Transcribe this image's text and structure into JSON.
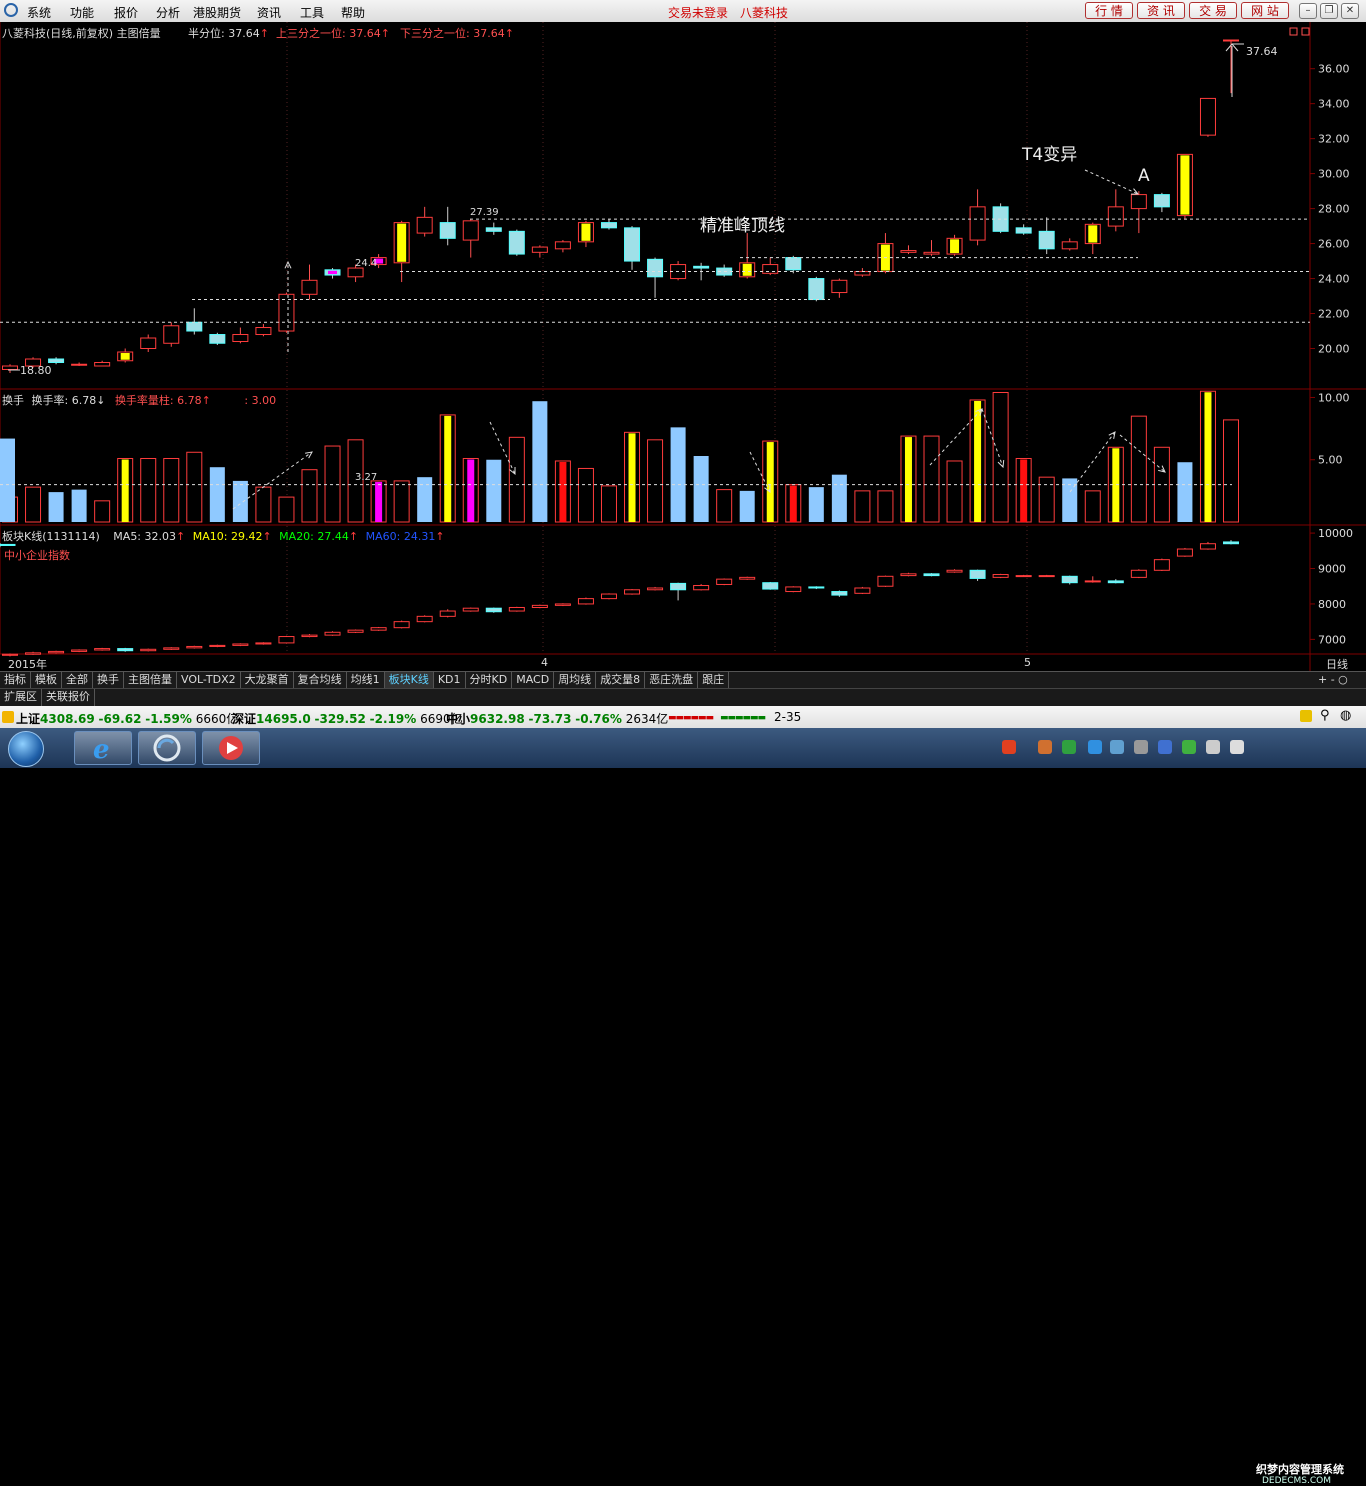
{
  "menu": {
    "items": [
      "系统",
      "功能",
      "报价",
      "分析",
      "港股期货",
      "资讯",
      "工具",
      "帮助"
    ],
    "status_login": "交易未登录",
    "status_brand": "八菱科技"
  },
  "toolbar": {
    "buttons": [
      "行 情",
      "资 讯",
      "交 易",
      "网 站"
    ]
  },
  "main_header": {
    "title": "八菱科技(日线,前复权) 主图倍量",
    "items": [
      {
        "label": "半分位:",
        "value": "37.64",
        "arrow": "↑"
      },
      {
        "label": "上三分之一位:",
        "value": "37.64",
        "arrow": "↑"
      },
      {
        "label": "下三分之一位:",
        "value": "37.64",
        "arrow": "↑"
      }
    ]
  },
  "annotations": {
    "peak_line": "精准峰顶线",
    "t4": "T4变异",
    "a": "A",
    "high": "37.64",
    "low": "18.80",
    "p2739": "27.39",
    "p244": "24.4",
    "p327": "3.27"
  },
  "vol_header": {
    "name": "换手",
    "l1": "换手率:",
    "v1": "6.78",
    "a1": "↓",
    "l2": "换手率量柱:",
    "v2": "6.78",
    "a2": "↑",
    "v3": ": 3.00"
  },
  "block_header": {
    "name": "板块K线(1131114)",
    "ma5": "MA5: 32.03",
    "ma10": "MA10: 29.42",
    "ma20": "MA20: 27.44",
    "ma60": "MA60: 24.31",
    "index_name": "中小企业指数"
  },
  "x_labels": {
    "year": "2015年",
    "m4": "4",
    "m5": "5",
    "period": "日线"
  },
  "tabs": [
    "指标",
    "模板",
    "全部",
    "换手",
    "主图倍量",
    "VOL-TDX2",
    "大龙聚首",
    "复合均线",
    "均线1",
    "板块K线",
    "KD1",
    "分时KD",
    "MACD",
    "周均线",
    "成交量8",
    "恶庄洗盘",
    "跟庄"
  ],
  "tab_active": "板块K线",
  "tabs2": [
    "扩展区",
    "关联报价"
  ],
  "ticker": {
    "sh": {
      "name": "上证",
      "price": "4308.69",
      "chg": "-69.62",
      "pct": "-1.59%",
      "amt": "6660亿"
    },
    "sz": {
      "name": "深证",
      "price": "14695.0",
      "chg": "-329.52",
      "pct": "-2.19%",
      "amt": "6690亿"
    },
    "zx": {
      "name": "中小",
      "price": "9632.98",
      "chg": "-73.73",
      "pct": "-0.76%",
      "amt": "2634亿"
    },
    "range": "2-35"
  },
  "watermark": "织梦内容管理系统",
  "watermark2": "DEDECMS.COM",
  "colors": {
    "up": "#ff3c3c",
    "down": "#54ffff",
    "bg": "#000000",
    "grid": "#800000",
    "yellow": "#ffff00",
    "magenta": "#ff00ff",
    "lightblue": "#8fc9ff"
  },
  "chart_data": {
    "type": "candlestick",
    "main": {
      "ylim": [
        19,
        37.64
      ],
      "yticks": [
        20,
        22,
        24,
        26,
        28,
        30,
        32,
        34,
        36
      ],
      "candles": [
        [
          18.8,
          19.0,
          18.6,
          19.1
        ],
        [
          19.0,
          19.4,
          18.9,
          19.5
        ],
        [
          19.4,
          19.2,
          19.1,
          19.5
        ],
        [
          19.1,
          19.1,
          19.0,
          19.2
        ],
        [
          19.0,
          19.2,
          19.0,
          19.3
        ],
        [
          19.3,
          19.8,
          19.2,
          20.0
        ],
        [
          20.0,
          20.6,
          19.8,
          20.8
        ],
        [
          20.3,
          21.3,
          20.1,
          21.5
        ],
        [
          21.5,
          21.0,
          20.8,
          22.3
        ],
        [
          20.8,
          20.3,
          20.2,
          20.9
        ],
        [
          20.4,
          20.8,
          20.3,
          21.2
        ],
        [
          20.8,
          21.2,
          20.7,
          21.4
        ],
        [
          21.0,
          23.1,
          20.9,
          23.2
        ],
        [
          23.1,
          23.9,
          22.8,
          24.8
        ],
        [
          24.5,
          24.2,
          24.0,
          24.6
        ],
        [
          24.1,
          24.6,
          23.8,
          24.8
        ],
        [
          24.8,
          25.2,
          24.6,
          25.4
        ],
        [
          24.9,
          27.2,
          23.8,
          27.3
        ],
        [
          26.6,
          27.5,
          26.4,
          28.1
        ],
        [
          27.2,
          26.3,
          25.9,
          28.1
        ],
        [
          26.2,
          27.3,
          25.2,
          27.4
        ],
        [
          26.9,
          26.7,
          26.5,
          27.2
        ],
        [
          26.7,
          25.4,
          25.3,
          26.8
        ],
        [
          25.5,
          25.8,
          25.2,
          25.9
        ],
        [
          25.7,
          26.1,
          25.5,
          26.2
        ],
        [
          26.1,
          27.2,
          25.8,
          27.3
        ],
        [
          27.2,
          26.9,
          26.8,
          27.4
        ],
        [
          26.9,
          25.0,
          24.5,
          27.0
        ],
        [
          25.1,
          24.1,
          22.9,
          25.2
        ],
        [
          24.0,
          24.8,
          23.9,
          25.0
        ],
        [
          24.7,
          24.6,
          23.9,
          24.9
        ],
        [
          24.6,
          24.2,
          24.1,
          24.8
        ],
        [
          24.1,
          24.9,
          24.0,
          26.6
        ],
        [
          24.3,
          24.8,
          24.2,
          25.2
        ],
        [
          25.2,
          24.5,
          24.3,
          25.3
        ],
        [
          24.0,
          22.8,
          22.7,
          24.1
        ],
        [
          23.2,
          23.9,
          22.9,
          24.0
        ],
        [
          24.2,
          24.4,
          24.1,
          24.6
        ],
        [
          24.4,
          26.0,
          24.3,
          26.6
        ],
        [
          25.5,
          25.6,
          25.4,
          25.9
        ],
        [
          25.4,
          25.5,
          25.3,
          26.2
        ],
        [
          25.4,
          26.3,
          25.3,
          26.5
        ],
        [
          26.2,
          28.1,
          25.9,
          29.1
        ],
        [
          28.1,
          26.7,
          26.6,
          28.3
        ],
        [
          26.9,
          26.6,
          26.5,
          27.1
        ],
        [
          26.7,
          25.7,
          25.4,
          27.5
        ],
        [
          25.7,
          26.1,
          25.6,
          26.3
        ],
        [
          26.0,
          27.1,
          25.4,
          27.2
        ],
        [
          27.0,
          28.1,
          26.7,
          29.1
        ],
        [
          28.0,
          28.8,
          26.6,
          29.0
        ],
        [
          28.8,
          28.1,
          27.8,
          28.9
        ],
        [
          27.6,
          31.1,
          27.4,
          31.1
        ],
        [
          32.2,
          34.3,
          32.1,
          34.3
        ],
        [
          37.64,
          37.64,
          34.6,
          37.64
        ]
      ]
    },
    "volume": {
      "ylim": [
        0,
        10.6
      ],
      "yticks": [
        5,
        10
      ],
      "ref_line": 3.0,
      "values": [
        2.0,
        2.8,
        2.4,
        2.6,
        1.7,
        5.1,
        5.1,
        5.1,
        5.6,
        4.4,
        3.3,
        2.8,
        2.0,
        4.2,
        6.1,
        6.6,
        3.3,
        3.3,
        3.6,
        8.6,
        5.1,
        5.0,
        6.8,
        9.7,
        4.9,
        4.3,
        2.9,
        7.2,
        6.6,
        7.6,
        5.3,
        2.6,
        2.5,
        6.5,
        3.0,
        2.8,
        3.8,
        2.5,
        2.5,
        6.9,
        6.9,
        4.9,
        9.8,
        10.4,
        5.1,
        3.6,
        3.5,
        2.5,
        6.0,
        8.5,
        6.0,
        4.8,
        10.5,
        8.2,
        6.7
      ],
      "colors": [
        "open",
        "open",
        "lb",
        "lb",
        "open",
        "yl",
        "open",
        "open",
        "open",
        "lb",
        "lb",
        "open",
        "open",
        "open",
        "open",
        "open",
        "mg",
        "open",
        "lb",
        "yl",
        "mg",
        "lb",
        "open",
        "lb",
        "rd",
        "open",
        "open",
        "yl",
        "open",
        "lb",
        "lb",
        "open",
        "lb",
        "yl",
        "rd",
        "lb",
        "lb",
        "open",
        "open",
        "yl",
        "open",
        "open",
        "yl",
        "open",
        "rd",
        "open",
        "lb",
        "open",
        "yl",
        "open",
        "open",
        "lb",
        "yl",
        "open",
        "lb"
      ]
    },
    "block": {
      "ylim": [
        6700,
        10200
      ],
      "yticks": [
        7000,
        8000,
        9000,
        10000
      ],
      "candles": [
        [
          6550,
          6580,
          6520,
          6600
        ],
        [
          6580,
          6620,
          6560,
          6650
        ],
        [
          6620,
          6660,
          6600,
          6680
        ],
        [
          6660,
          6700,
          6640,
          6720
        ],
        [
          6700,
          6740,
          6680,
          6760
        ],
        [
          6740,
          6680,
          6650,
          6760
        ],
        [
          6680,
          6720,
          6660,
          6740
        ],
        [
          6720,
          6760,
          6700,
          6780
        ],
        [
          6760,
          6800,
          6740,
          6820
        ],
        [
          6800,
          6830,
          6780,
          6850
        ],
        [
          6830,
          6870,
          6810,
          6890
        ],
        [
          6870,
          6900,
          6850,
          6920
        ],
        [
          6900,
          7080,
          6880,
          7100
        ],
        [
          7080,
          7120,
          7060,
          7150
        ],
        [
          7120,
          7200,
          7100,
          7230
        ],
        [
          7200,
          7260,
          7180,
          7280
        ],
        [
          7260,
          7330,
          7240,
          7350
        ],
        [
          7330,
          7500,
          7310,
          7530
        ],
        [
          7500,
          7650,
          7480,
          7680
        ],
        [
          7650,
          7800,
          7620,
          7850
        ],
        [
          7800,
          7880,
          7780,
          7900
        ],
        [
          7880,
          7780,
          7750,
          7900
        ],
        [
          7800,
          7900,
          7780,
          7920
        ],
        [
          7900,
          7960,
          7880,
          7980
        ],
        [
          7960,
          8000,
          7940,
          8020
        ],
        [
          8000,
          8150,
          7980,
          8180
        ],
        [
          8150,
          8280,
          8130,
          8300
        ],
        [
          8280,
          8400,
          8260,
          8420
        ],
        [
          8400,
          8450,
          8380,
          8480
        ],
        [
          8580,
          8400,
          8100,
          8600
        ],
        [
          8400,
          8520,
          8380,
          8560
        ],
        [
          8550,
          8700,
          8530,
          8720
        ],
        [
          8700,
          8750,
          8680,
          8770
        ],
        [
          8600,
          8420,
          8400,
          8620
        ],
        [
          8350,
          8480,
          8330,
          8500
        ],
        [
          8480,
          8450,
          8420,
          8500
        ],
        [
          8350,
          8250,
          8200,
          8380
        ],
        [
          8300,
          8450,
          8280,
          8480
        ],
        [
          8500,
          8780,
          8480,
          8800
        ],
        [
          8800,
          8850,
          8780,
          8880
        ],
        [
          8850,
          8800,
          8780,
          8870
        ],
        [
          8900,
          8950,
          8880,
          8980
        ],
        [
          8950,
          8720,
          8650,
          8970
        ],
        [
          8750,
          8830,
          8730,
          8850
        ],
        [
          8800,
          8800,
          8780,
          8820
        ],
        [
          8780,
          8800,
          8760,
          8820
        ],
        [
          8780,
          8600,
          8550,
          8800
        ],
        [
          8650,
          8650,
          8600,
          8780
        ],
        [
          8650,
          8600,
          8580,
          8700
        ],
        [
          8750,
          8950,
          8730,
          8980
        ],
        [
          8950,
          9250,
          8930,
          9280
        ],
        [
          9350,
          9550,
          9330,
          9580
        ],
        [
          9550,
          9700,
          9530,
          9750
        ],
        [
          9750,
          9700,
          9680,
          9800
        ],
        [
          9680,
          9650,
          9600,
          9720
        ]
      ]
    }
  }
}
